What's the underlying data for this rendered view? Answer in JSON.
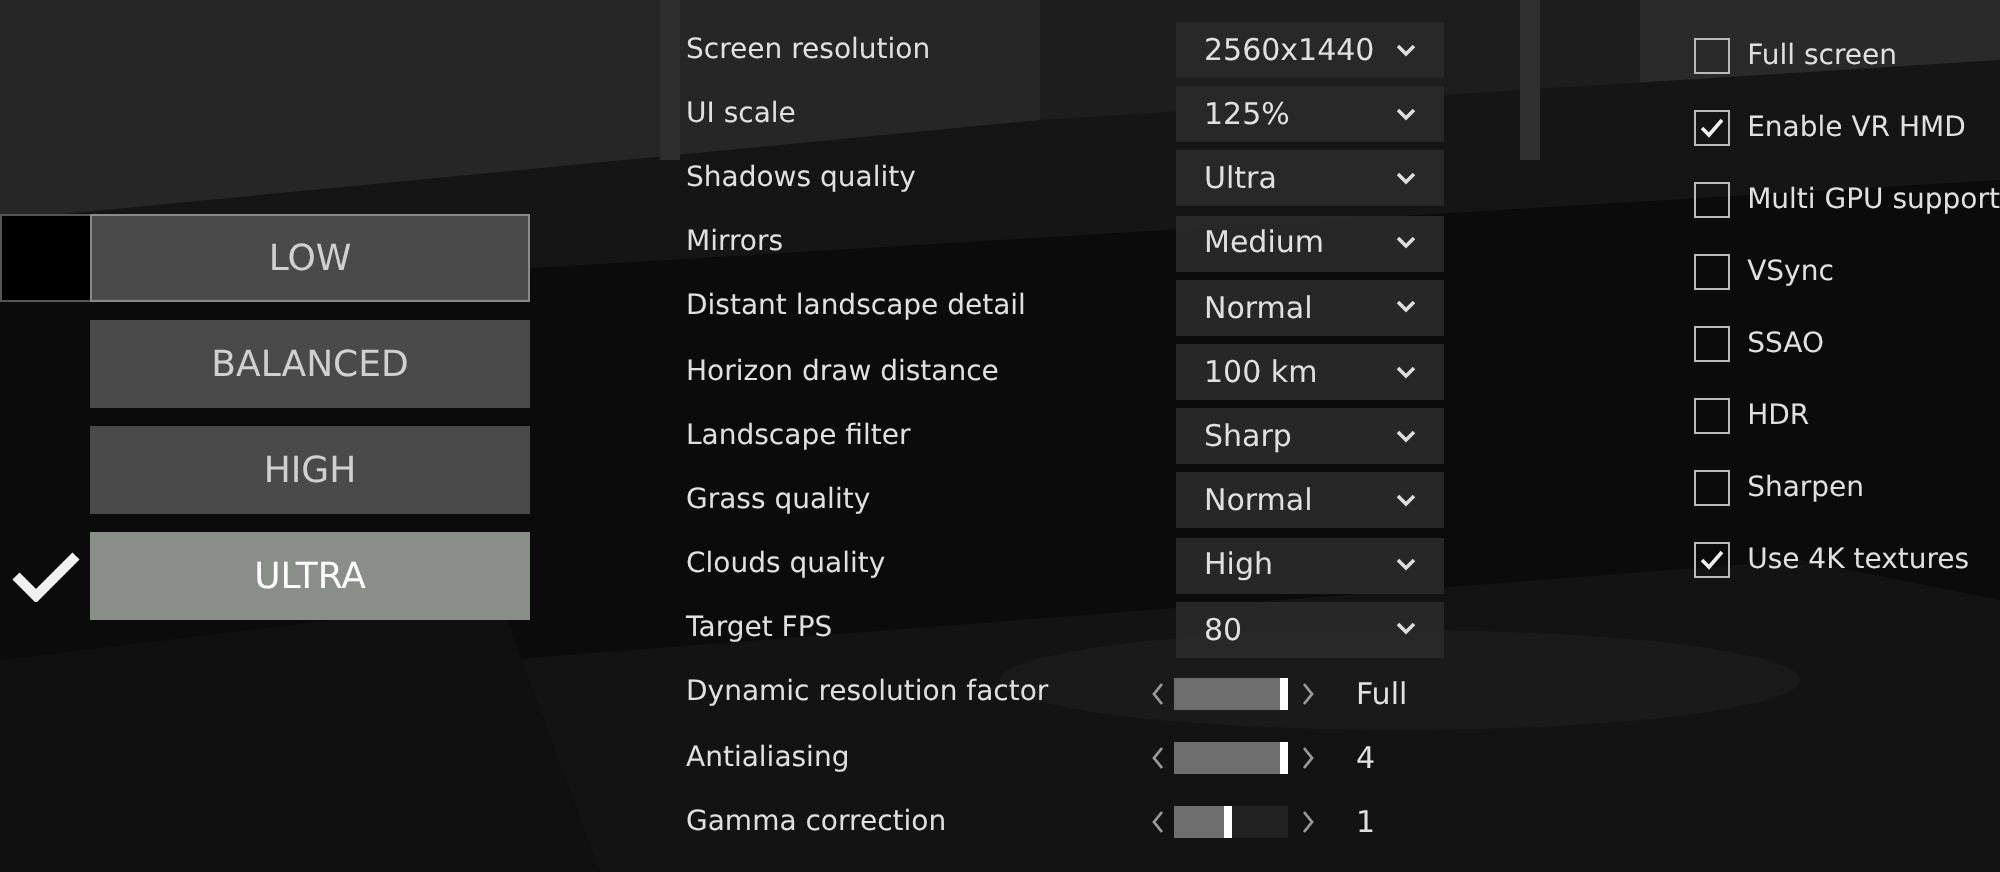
{
  "presets": [
    {
      "label": "LOW",
      "selected": false,
      "focused": true
    },
    {
      "label": "BALANCED",
      "selected": false,
      "focused": false
    },
    {
      "label": "HIGH",
      "selected": false,
      "focused": false
    },
    {
      "label": "ULTRA",
      "selected": true,
      "focused": false
    }
  ],
  "settings": [
    {
      "kind": "dropdown",
      "label": "Screen resolution",
      "value": "2560x1440"
    },
    {
      "kind": "dropdown",
      "label": "UI scale",
      "value": "125%"
    },
    {
      "kind": "dropdown",
      "label": "Shadows quality",
      "value": "Ultra"
    },
    {
      "kind": "dropdown",
      "label": "Mirrors",
      "value": "Medium"
    },
    {
      "kind": "dropdown",
      "label": "Distant landscape detail",
      "value": "Normal"
    },
    {
      "kind": "dropdown",
      "label": "Horizon draw distance",
      "value": "100 km"
    },
    {
      "kind": "dropdown",
      "label": "Landscape filter",
      "value": "Sharp"
    },
    {
      "kind": "dropdown",
      "label": "Grass quality",
      "value": "Normal"
    },
    {
      "kind": "dropdown",
      "label": "Clouds quality",
      "value": "High"
    },
    {
      "kind": "dropdown",
      "label": "Target FPS",
      "value": "80"
    },
    {
      "kind": "slider",
      "label": "Dynamic resolution factor",
      "level": 1,
      "value": "Full"
    },
    {
      "kind": "slider",
      "label": "Antialiasing",
      "level": 1,
      "value": "4"
    },
    {
      "kind": "slider",
      "label": "Gamma correction",
      "level": 0.5,
      "value": "1"
    }
  ],
  "options": [
    {
      "label": "Full screen",
      "checked": false
    },
    {
      "label": "Enable VR HMD",
      "checked": true
    },
    {
      "label": "Multi GPU support",
      "checked": false
    },
    {
      "label": "VSync",
      "checked": false
    },
    {
      "label": "SSAO",
      "checked": false
    },
    {
      "label": "HDR",
      "checked": false
    },
    {
      "label": "Sharpen",
      "checked": false
    },
    {
      "label": "Use 4K textures",
      "checked": true
    }
  ]
}
